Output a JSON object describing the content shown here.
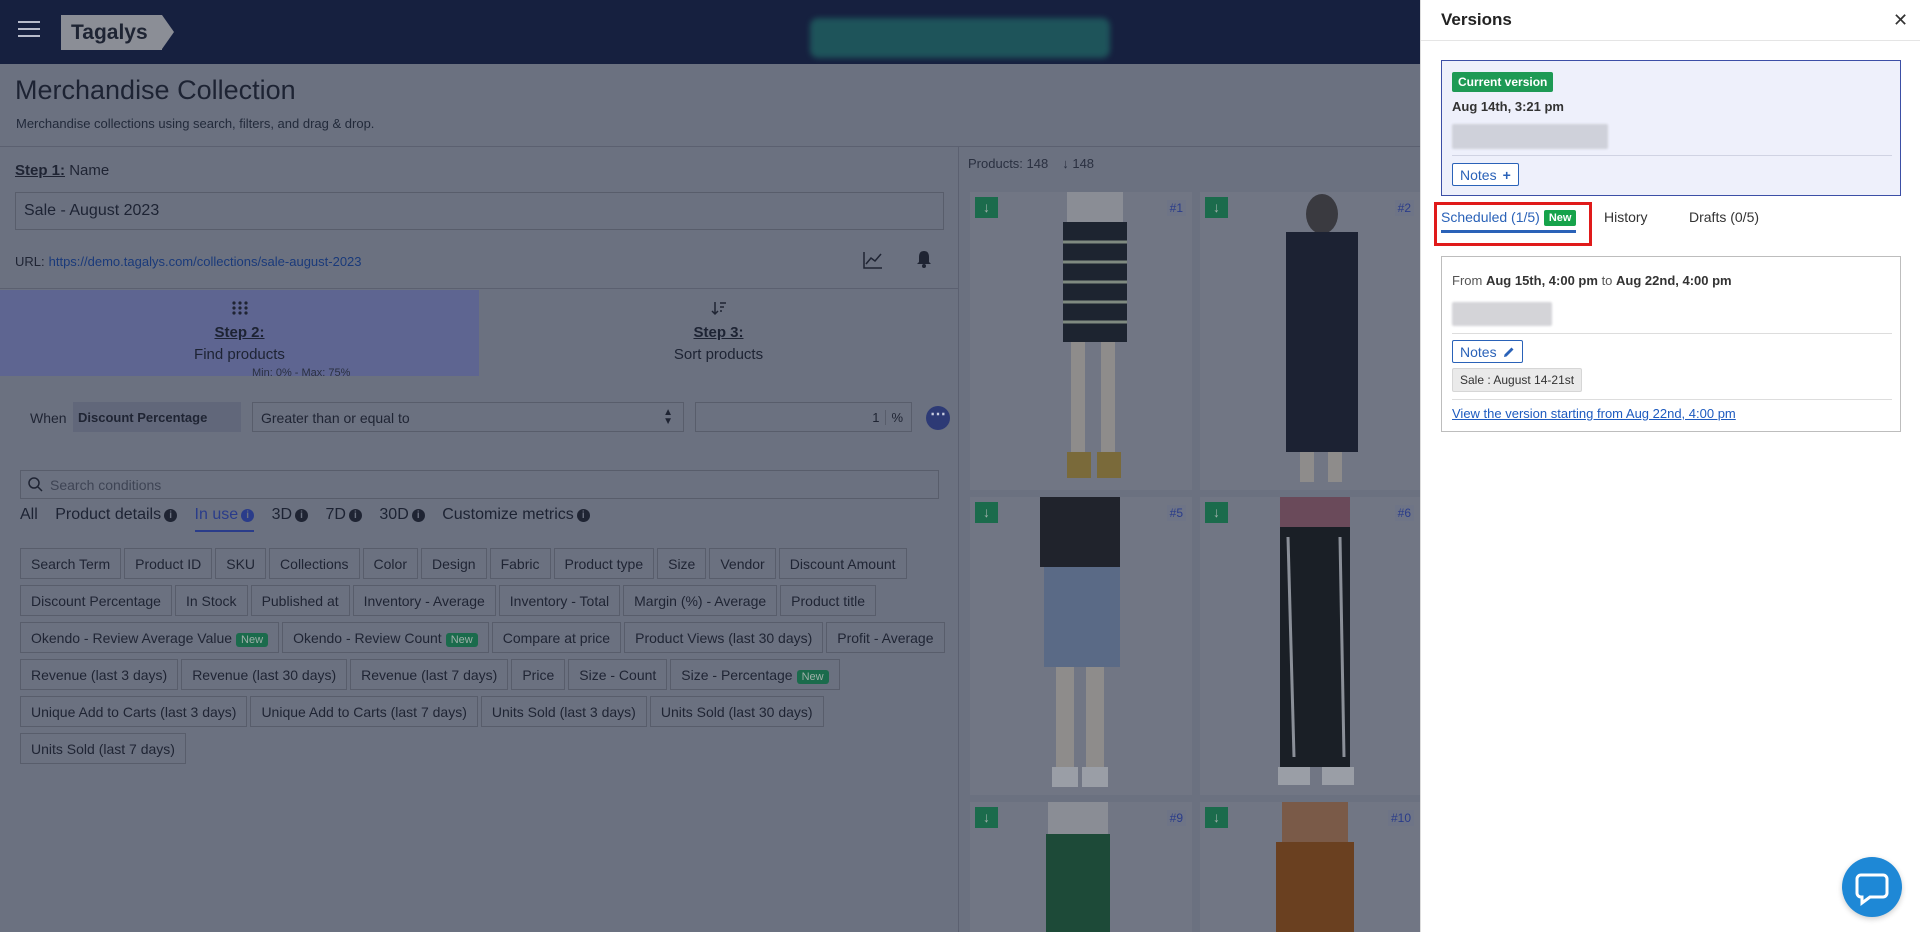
{
  "topbar": {
    "logo_text": "Tagalys"
  },
  "page": {
    "title": "Merchandise Collection",
    "subtitle": "Merchandise collections using search, filters, and drag & drop."
  },
  "step1": {
    "label": "Step 1:",
    "text": "Name",
    "name_value": "Sale - August 2023"
  },
  "url": {
    "label": "URL:",
    "link": "https://demo.tagalys.com/collections/sale-august-2023"
  },
  "steps": [
    {
      "label": "Step 2:",
      "text": "Find products"
    },
    {
      "label": "Step 3:",
      "text": "Sort products"
    }
  ],
  "condition": {
    "when": "When",
    "field": "Discount Percentage",
    "operator": "Greater than or equal to",
    "value": "1",
    "unit": "%",
    "hint": "Min: 0% - Max: 75%"
  },
  "search_conditions": {
    "placeholder": "Search conditions"
  },
  "filter_tabs": [
    "All",
    "Product details",
    "In use",
    "3D",
    "7D",
    "30D",
    "Customize metrics"
  ],
  "chips": [
    {
      "label": "Search Term"
    },
    {
      "label": "Product ID"
    },
    {
      "label": "SKU"
    },
    {
      "label": "Collections"
    },
    {
      "label": "Color"
    },
    {
      "label": "Design"
    },
    {
      "label": "Fabric"
    },
    {
      "label": "Product type"
    },
    {
      "label": "Size"
    },
    {
      "label": "Vendor"
    },
    {
      "label": "Discount Amount"
    },
    {
      "label": "Discount Percentage"
    },
    {
      "label": "In Stock"
    },
    {
      "label": "Published at"
    },
    {
      "label": "Inventory - Average"
    },
    {
      "label": "Inventory - Total"
    },
    {
      "label": "Margin (%) - Average"
    },
    {
      "label": "Product title"
    },
    {
      "label": "Okendo - Review Average Value",
      "badge": "New"
    },
    {
      "label": "Okendo - Review Count",
      "badge": "New"
    },
    {
      "label": "Compare at price"
    },
    {
      "label": "Product Views (last 30 days)"
    },
    {
      "label": "Profit - Average"
    },
    {
      "label": "Revenue (last 3 days)"
    },
    {
      "label": "Revenue (last 30 days)"
    },
    {
      "label": "Revenue (last 7 days)"
    },
    {
      "label": "Price"
    },
    {
      "label": "Size - Count"
    },
    {
      "label": "Size - Percentage",
      "badge": "New"
    },
    {
      "label": "Unique Add to Carts (last 3 days)"
    },
    {
      "label": "Unique Add to Carts (last 7 days)"
    },
    {
      "label": "Units Sold (last 3 days)"
    },
    {
      "label": "Units Sold (last 30 days)"
    },
    {
      "label": "Units Sold (last 7 days)"
    }
  ],
  "products": {
    "count_label": "Products: 148",
    "sort_count": "148",
    "tiles": [
      "#1",
      "#2",
      "#5",
      "#6",
      "#9",
      "#10"
    ]
  },
  "versions": {
    "title": "Versions",
    "current": {
      "badge": "Current version",
      "date": "Aug 14th, 3:21 pm",
      "notes_label": "Notes"
    },
    "tabs": {
      "scheduled": "Scheduled (1/5)",
      "scheduled_badge": "New",
      "history": "History",
      "drafts": "Drafts (0/5)"
    },
    "scheduled": {
      "from_word": "From",
      "from": "Aug 15th, 4:00 pm",
      "to_word": "to",
      "to": "Aug 22nd, 4:00 pm",
      "notes_label": "Notes",
      "tag": "Sale : August 14-21st",
      "link": "View the version starting from Aug 22nd, 4:00 pm"
    }
  }
}
